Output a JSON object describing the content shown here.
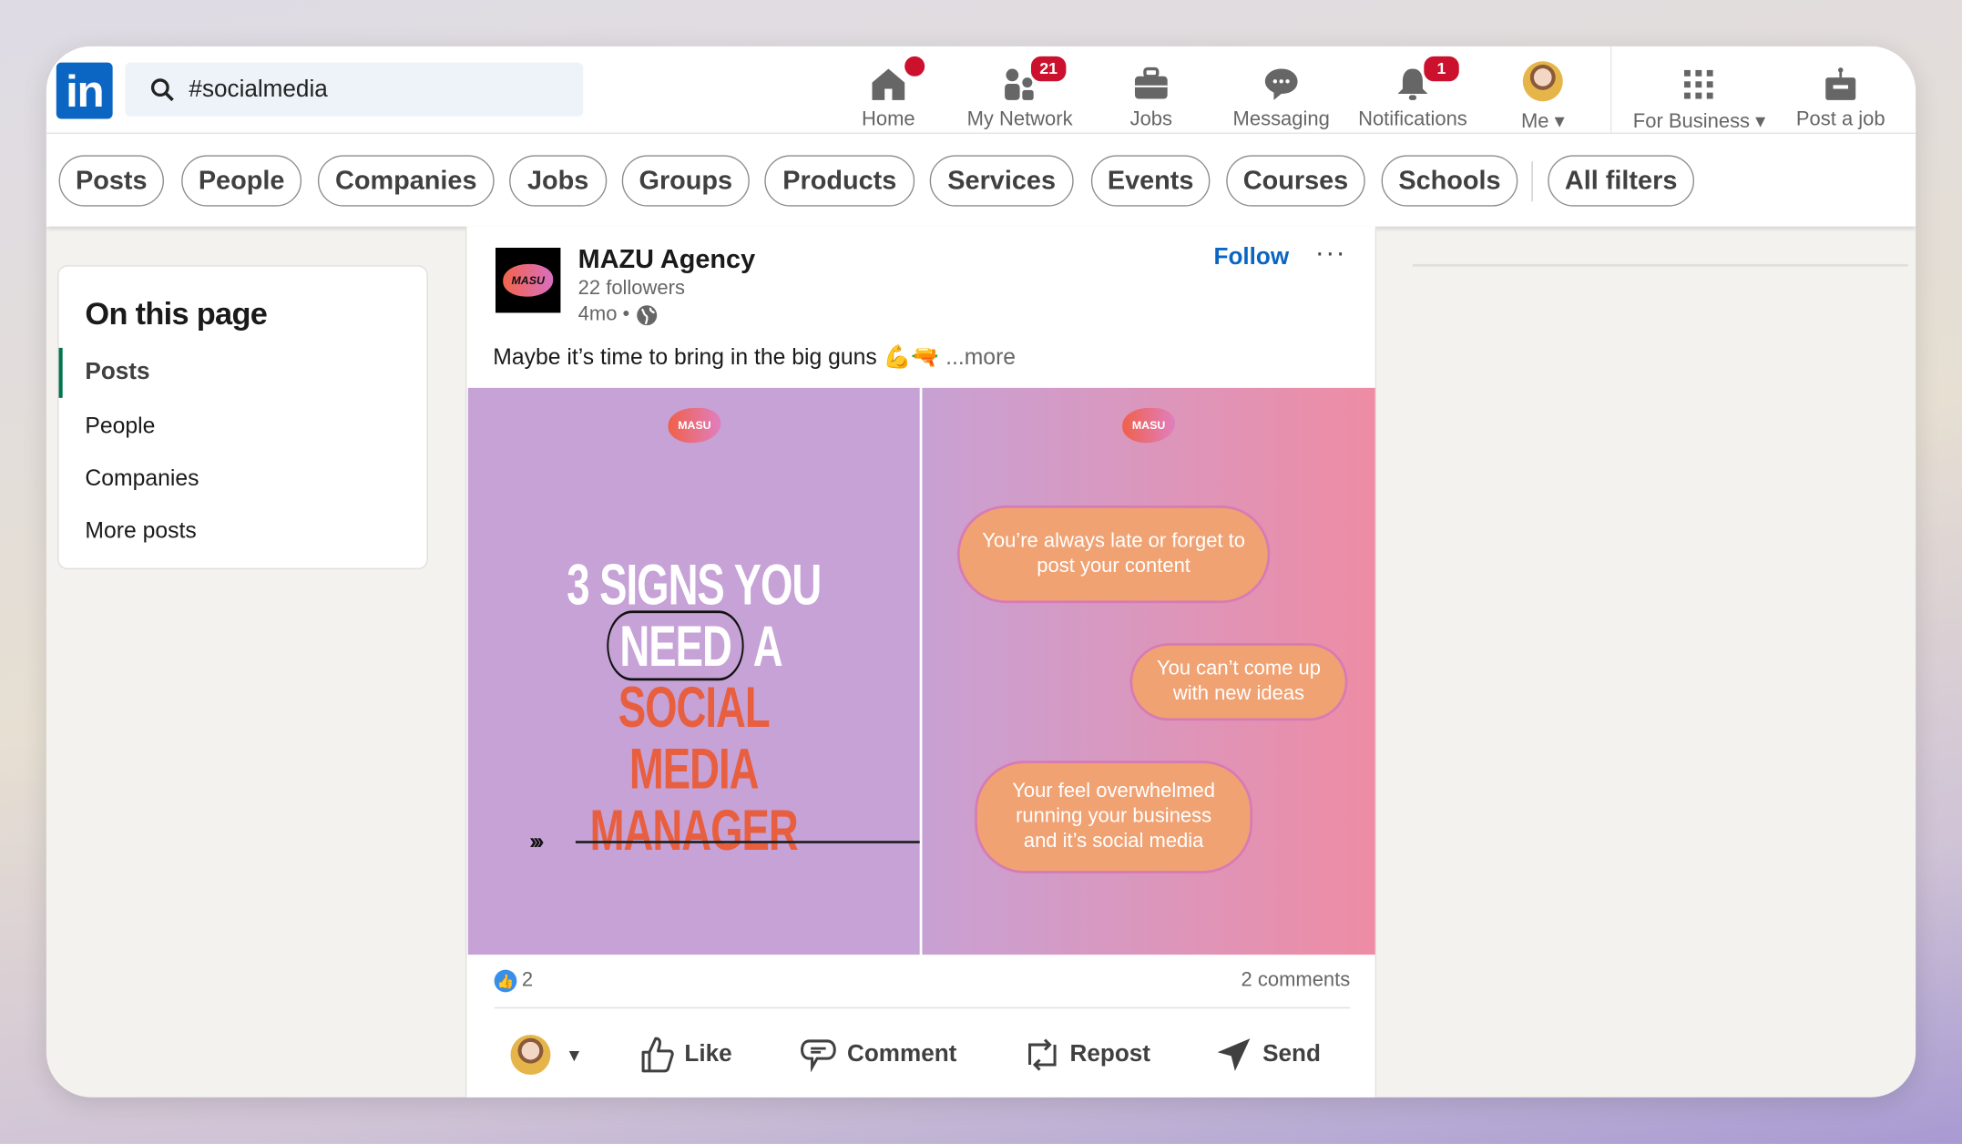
{
  "search": {
    "value": "#socialmedia"
  },
  "logo": {
    "text": "in"
  },
  "nav": [
    {
      "label": "Home",
      "icon": "home-icon",
      "badge": ""
    },
    {
      "label": "My Network",
      "icon": "network-icon",
      "badge": "21"
    },
    {
      "label": "Jobs",
      "icon": "briefcase-icon",
      "badge": ""
    },
    {
      "label": "Messaging",
      "icon": "chat-icon",
      "badge": ""
    },
    {
      "label": "Notifications",
      "icon": "bell-icon",
      "badge": "1"
    },
    {
      "label": "Me",
      "icon": "avatar-icon",
      "badge": ""
    },
    {
      "label": "For Business",
      "icon": "grid-icon",
      "badge": ""
    },
    {
      "label": "Post a job",
      "icon": "post-job-icon",
      "badge": ""
    }
  ],
  "filters": [
    "Posts",
    "People",
    "Companies",
    "Jobs",
    "Groups",
    "Products",
    "Services",
    "Events",
    "Courses",
    "Schools",
    "All filters"
  ],
  "sidebar": {
    "title": "On this page",
    "items": [
      "Posts",
      "People",
      "Companies",
      "More posts"
    ]
  },
  "post": {
    "author": "MAZU Agency",
    "followers": "22 followers",
    "time": "4mo •",
    "follow": "Follow",
    "menu": "···",
    "text": "Maybe it’s time to bring in the big guns 💪🔫",
    "more": "...more",
    "logo_text": "MASU",
    "slide1": {
      "line1": "3 SIGNS YOU",
      "need": "NEED",
      "a": "A",
      "social": "SOCIAL",
      "line3": "MEDIA MANAGER",
      "arrows": "›››"
    },
    "slide2": [
      "You’re always late or forget to post your content",
      "You can’t come up with new ideas",
      "Your feel overwhelmed running your business and it’s social media"
    ],
    "reactions": "2",
    "comments": "2 comments",
    "actions": [
      "Like",
      "Comment",
      "Repost",
      "Send"
    ]
  },
  "colors": {
    "brand": "#0a66c2",
    "badge": "#cb112d",
    "active": "#01754f"
  }
}
